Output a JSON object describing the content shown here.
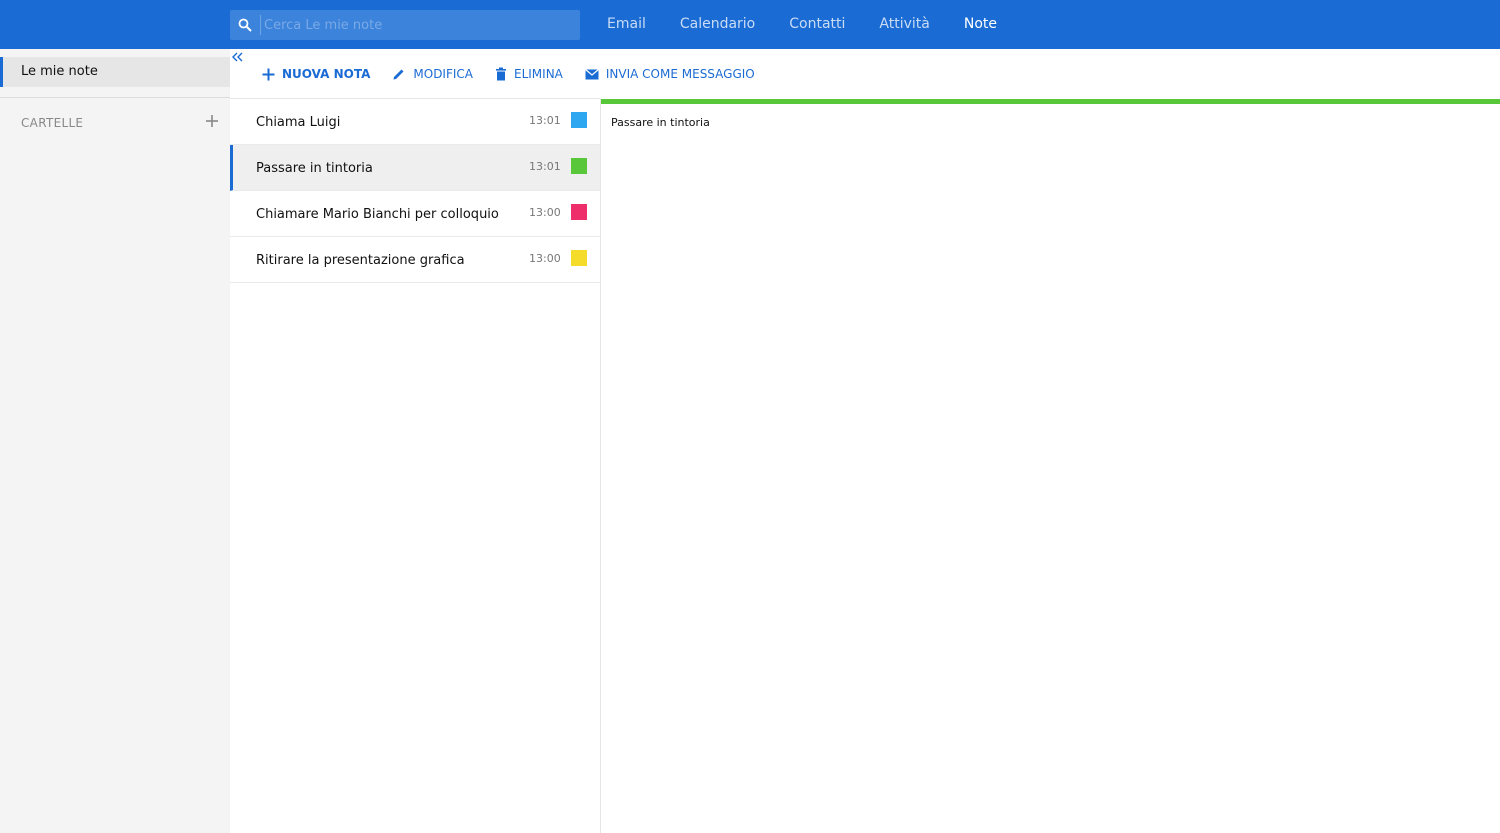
{
  "search": {
    "placeholder": "Cerca Le mie note"
  },
  "topnav": {
    "items": [
      {
        "label": "Email"
      },
      {
        "label": "Calendario"
      },
      {
        "label": "Contatti"
      },
      {
        "label": "Attività"
      },
      {
        "label": "Note"
      }
    ],
    "active": "Note"
  },
  "sidebar": {
    "folder_label": "Le mie note",
    "section_label": "CARTELLE"
  },
  "toolbar": {
    "new_label": "NUOVA NOTA",
    "edit_label": "MODIFICA",
    "delete_label": "ELIMINA",
    "send_label": "INVIA COME MESSAGGIO"
  },
  "notes": [
    {
      "title": "Chiama Luigi",
      "time": "13:01",
      "color": "#2ea7f0"
    },
    {
      "title": "Passare in tintoria",
      "time": "13:01",
      "color": "#59c73a"
    },
    {
      "title": "Chiamare Mario Bianchi per colloquio",
      "time": "13:00",
      "color": "#ee2d6b"
    },
    {
      "title": "Ritirare la presentazione grafica",
      "time": "13:00",
      "color": "#f5dc2a"
    }
  ],
  "selected_note": {
    "title": "Passare in tintoria",
    "color": "#59c73a"
  },
  "colors": {
    "accent": "#1a6bd3",
    "sidebar_bg": "#f4f4f4"
  },
  "icons": {
    "search": "search-icon",
    "add_folder": "plus-icon",
    "collapse": "double-chevron-left-icon",
    "new": "plus-icon",
    "edit": "pencil-icon",
    "delete": "trash-icon",
    "send": "envelope-icon"
  }
}
